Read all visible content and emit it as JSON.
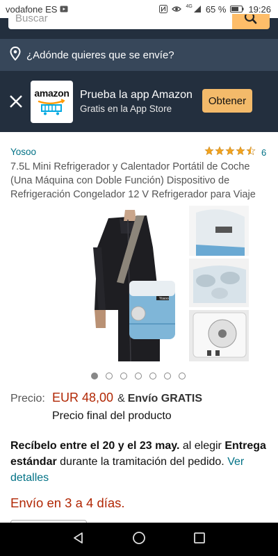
{
  "status_bar": {
    "carrier": "vodafone ES",
    "network": "4G",
    "battery": "65 %",
    "time": "19:26"
  },
  "search": {
    "placeholder": "Buscar"
  },
  "deliver_to": {
    "label": "¿Adónde quieres que se envíe?"
  },
  "app_banner": {
    "logo_text": "amazon",
    "title": "Prueba la app Amazon",
    "subtitle": "Gratis en la App Store",
    "button_label": "Obtener"
  },
  "product": {
    "brand": "Yosoo",
    "rating": 4.5,
    "review_count": "6",
    "title": "7.5L Mini Refrigerador y Calentador Portátil de Coche (Una Máquina con Doble Función) Dispositivo de Refrigeración Congelador 12 V Refrigerador para Viaje",
    "image_brand_label": "Yosoo",
    "image_count": 7,
    "active_image": 1
  },
  "price": {
    "label": "Precio:",
    "value": "EUR 48,00",
    "amp": "&",
    "shipping": "Envío GRATIS",
    "final_note": "Precio final del producto"
  },
  "delivery": {
    "prefix": "Recíbelo entre el 20 y el 23 may.",
    "middle": " al elegir ",
    "option": "Entrega estándar",
    "suffix": " durante la tramitación del pedido. ",
    "link": "Ver detalles"
  },
  "ships_in": "Envío en 3 a 4 días.",
  "colors": {
    "header": "#232f3e",
    "deliver_bar": "#37475a",
    "link": "#007185",
    "price": "#b12704",
    "button": "#f3ba6a",
    "star": "#f4a41d"
  }
}
